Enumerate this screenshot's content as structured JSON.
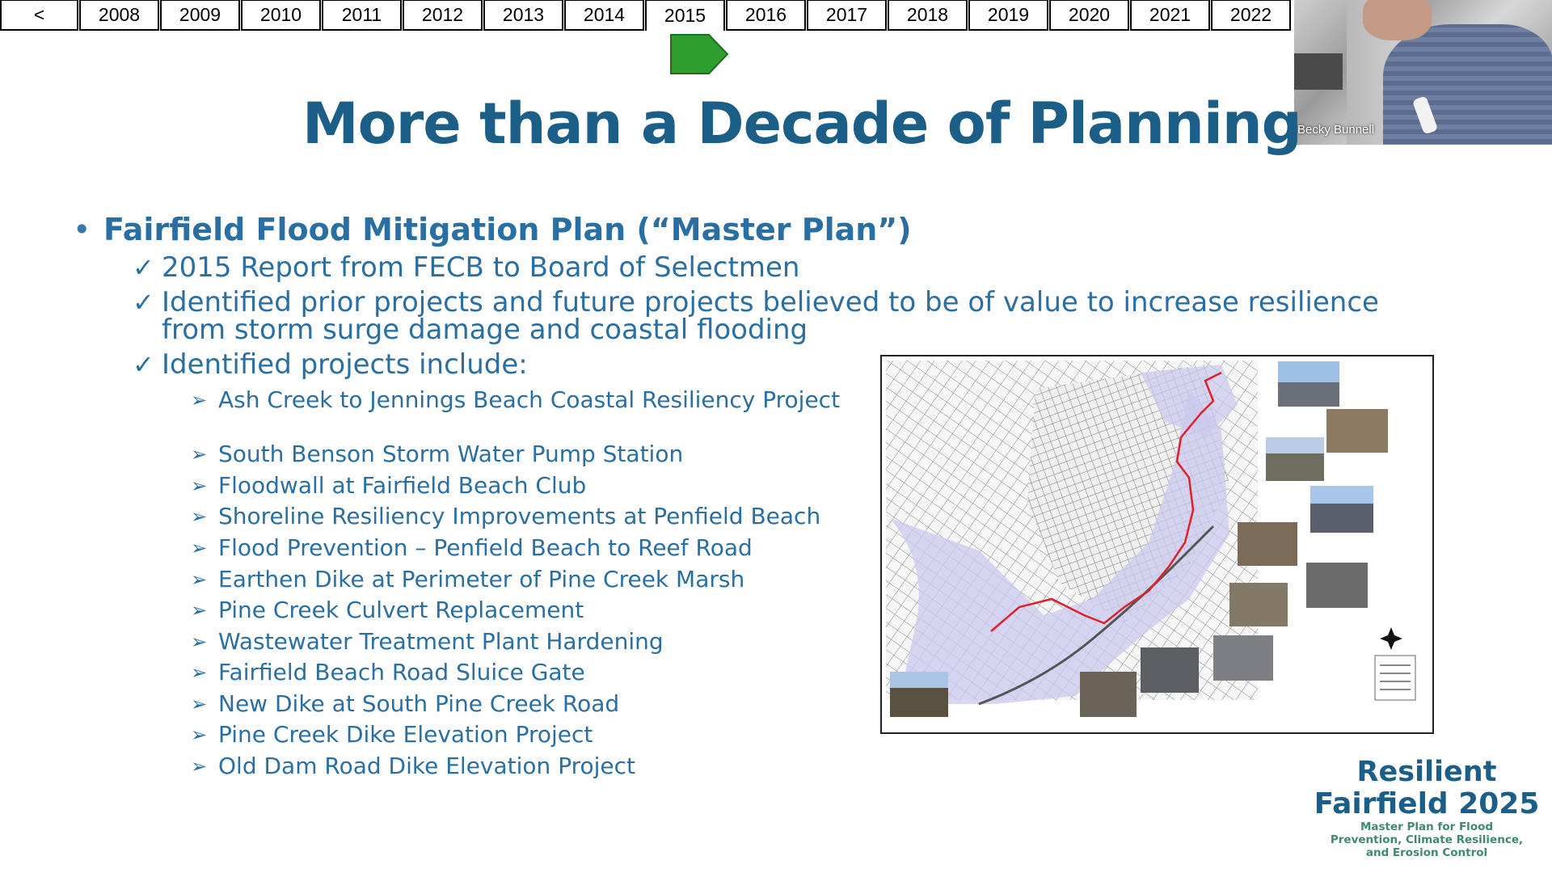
{
  "timeline": {
    "back_label": "<",
    "years": [
      "2008",
      "2009",
      "2010",
      "2011",
      "2012",
      "2013",
      "2014",
      "2015",
      "2016",
      "2017",
      "2018",
      "2019",
      "2020",
      "2021",
      "2022"
    ],
    "active_year": "2015"
  },
  "marker": {
    "color": "#2e9e2e",
    "icon": "arrow-right-marker"
  },
  "video": {
    "participant_name": "Becky Bunnell"
  },
  "slide": {
    "title": "More than a Decade of Planning",
    "main_bullet": "Fairfield Flood Mitigation Plan (“Master Plan”)",
    "checks": [
      "2015 Report from FECB to Board of Selectmen",
      "Identified prior projects and future projects believed to be of value to increase resilience from storm surge damage and coastal flooding",
      "Identified projects include:"
    ],
    "check_symbol": "✓",
    "arrow_symbol": "➢",
    "projects": [
      "Ash Creek to Jennings Beach Coastal Resiliency Project",
      "South Benson Storm Water Pump Station",
      "Floodwall at Fairfield Beach Club",
      "Shoreline Resiliency Improvements at Penfield Beach",
      "Flood Prevention – Penfield Beach to Reef Road",
      "Earthen Dike at Perimeter of Pine Creek Marsh",
      "Pine Creek Culvert Replacement",
      "Wastewater Treatment Plant Hardening",
      "Fairfield Beach Road Sluice Gate",
      "New Dike at South Pine Creek Road",
      "Pine Creek Dike Elevation Project",
      "Old Dam Road Dike Elevation Project"
    ]
  },
  "logo": {
    "line1": "Resilient",
    "line2": "Fairfield 2025",
    "line3a": "Master Plan for Flood",
    "line3b": "Prevention, Climate Resilience,",
    "line3c": "and Erosion Control"
  },
  "colors": {
    "title": "#1b5e88",
    "body_text": "#2a6fa3",
    "flood_zone": "#c9c9ef",
    "boundary_line": "#e0202a"
  }
}
